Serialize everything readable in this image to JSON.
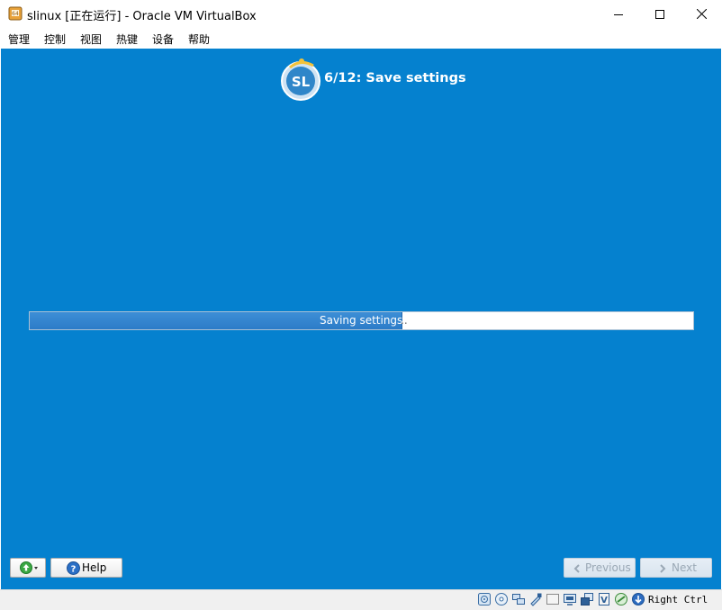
{
  "window": {
    "title": "slinux [正在运行] - Oracle VM VirtualBox",
    "controls": [
      "minimize",
      "maximize",
      "close"
    ]
  },
  "menu": {
    "items": [
      "管理",
      "控制",
      "视图",
      "热键",
      "设备",
      "帮助"
    ]
  },
  "installer": {
    "step_title": "6/12: Save settings",
    "logo_text": "SL",
    "progress_label": "Saving settings",
    "progress_dots": "..",
    "progress_fraction": 0.56
  },
  "buttons": {
    "help": "Help",
    "previous": "Previous",
    "next": "Next"
  },
  "statusbar": {
    "host_key": "Right Ctrl",
    "icons": [
      "hard-disk-icon",
      "optical-drive-icon",
      "network-icon",
      "usb-icon",
      "shared-folders-icon",
      "display-icon",
      "video-capture-icon",
      "cpu-icon",
      "mouse-integration-icon",
      "keyboard-capture-icon"
    ]
  },
  "colors": {
    "guest_background": "#0581cf",
    "progress_fill": "#2f80cc"
  }
}
